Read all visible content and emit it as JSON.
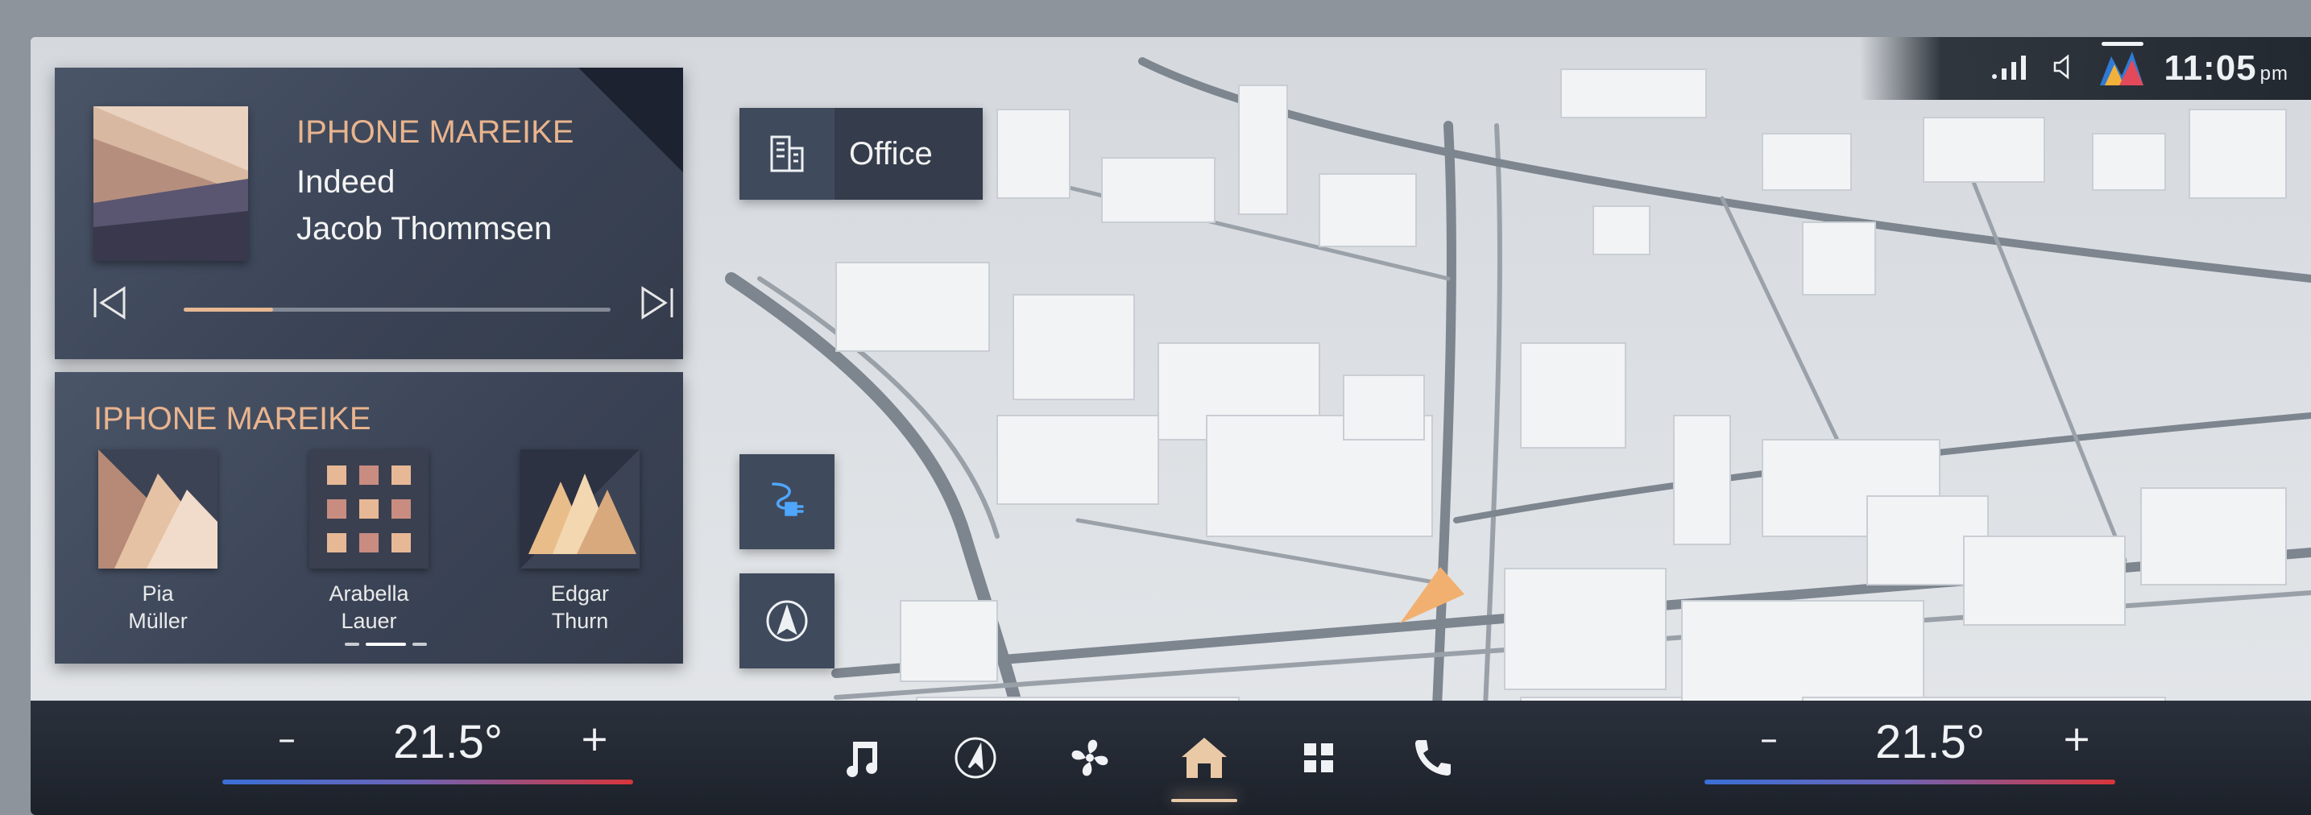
{
  "status_bar": {
    "time": "11:05",
    "ampm": "pm",
    "icons": [
      "signal-icon",
      "volume-icon",
      "app-logo-icon"
    ]
  },
  "now_playing": {
    "source": "IPHONE MAREIKE",
    "title": "Indeed",
    "artist": "Jacob Thommsen",
    "progress": 0.21,
    "prev_icon": "skip-previous-icon",
    "next_icon": "skip-next-icon"
  },
  "contacts_widget": {
    "source": "IPHONE MAREIKE",
    "contacts": [
      {
        "first": "Pia",
        "last": "Müller"
      },
      {
        "first": "Arabella",
        "last": "Lauer"
      },
      {
        "first": "Edgar",
        "last": "Thurn"
      }
    ],
    "page_index": 1,
    "page_count": 3
  },
  "destination": {
    "label": "Office",
    "icon": "building-icon"
  },
  "map_controls": [
    "charging-station-icon",
    "compass-icon"
  ],
  "climate": {
    "left": {
      "minus": "–",
      "value": "21.5°",
      "plus": "+"
    },
    "right": {
      "minus": "–",
      "value": "21.5°",
      "plus": "+"
    }
  },
  "dock": {
    "items": [
      "music-icon",
      "navigation-icon",
      "fan-icon",
      "home-icon",
      "apps-grid-icon",
      "phone-icon"
    ],
    "active": "home-icon"
  },
  "colors": {
    "accent": "#e9b48e",
    "card": "#3f4a5c",
    "dock": "#23282f"
  }
}
